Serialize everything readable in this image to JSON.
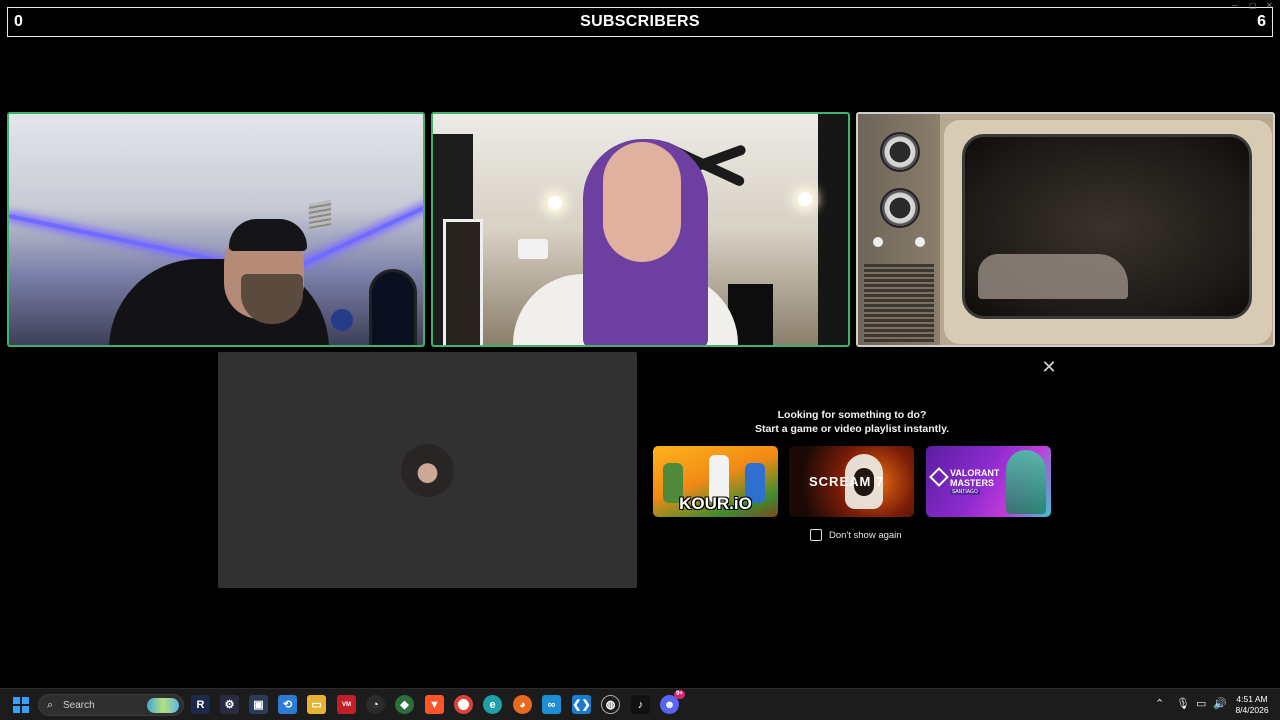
{
  "subscribers_bar": {
    "left_count": "0",
    "title": "SUBSCRIBERS",
    "right_count": "6"
  },
  "activity_panel": {
    "close_glyph": "✕",
    "prompt_line_1": "Looking for something to do?",
    "prompt_line_2": "Start a game or video playlist instantly.",
    "cards": [
      {
        "title": "KOUR.iO"
      },
      {
        "title": "SCREAM 7"
      },
      {
        "title": "VALORANT MASTERS",
        "subtitle": "SANTIAGO"
      }
    ],
    "dont_show_label": "Don't show again"
  },
  "taskbar": {
    "search_placeholder": "Search",
    "time": "4:51 AM",
    "date": "8/4/2026",
    "discord_badge": "9+",
    "accent_color": "#3aa0ff"
  },
  "colors": {
    "tile_border_active": "#3fb26b",
    "panel_background": "#000000",
    "waiting_tile_background": "#313131"
  }
}
